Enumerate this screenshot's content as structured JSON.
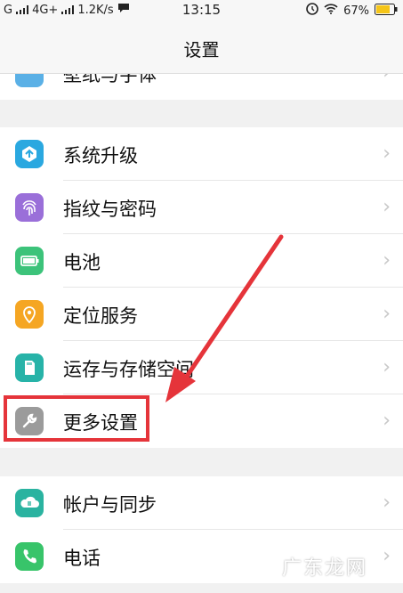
{
  "status_bar": {
    "carrier_g": "G",
    "net": "4G+",
    "speed": "1.2K/s",
    "time": "13:15",
    "battery": "67%"
  },
  "header": {
    "title": "设置"
  },
  "rows": [
    {
      "label": "壁纸与字体",
      "icon": "wallpaper-icon",
      "color": "#5ab0e6"
    },
    {
      "label": "系统升级",
      "icon": "upgrade-icon",
      "color": "#2aa8e0"
    },
    {
      "label": "指纹与密码",
      "icon": "fingerprint-icon",
      "color": "#9a6fd9"
    },
    {
      "label": "电池",
      "icon": "battery-icon",
      "color": "#3cc37a"
    },
    {
      "label": "定位服务",
      "icon": "location-icon",
      "color": "#f5a623"
    },
    {
      "label": "运存与存储空间",
      "icon": "storage-icon",
      "color": "#27b3a8"
    },
    {
      "label": "更多设置",
      "icon": "wrench-icon",
      "color": "#9b9b9b"
    },
    {
      "label": "帐户与同步",
      "icon": "cloud-sync-icon",
      "color": "#2ab3a0"
    },
    {
      "label": "电话",
      "icon": "phone-icon",
      "color": "#38c46a"
    }
  ],
  "watermark": "广东龙网",
  "colors": {
    "highlight": "#e5343a"
  }
}
